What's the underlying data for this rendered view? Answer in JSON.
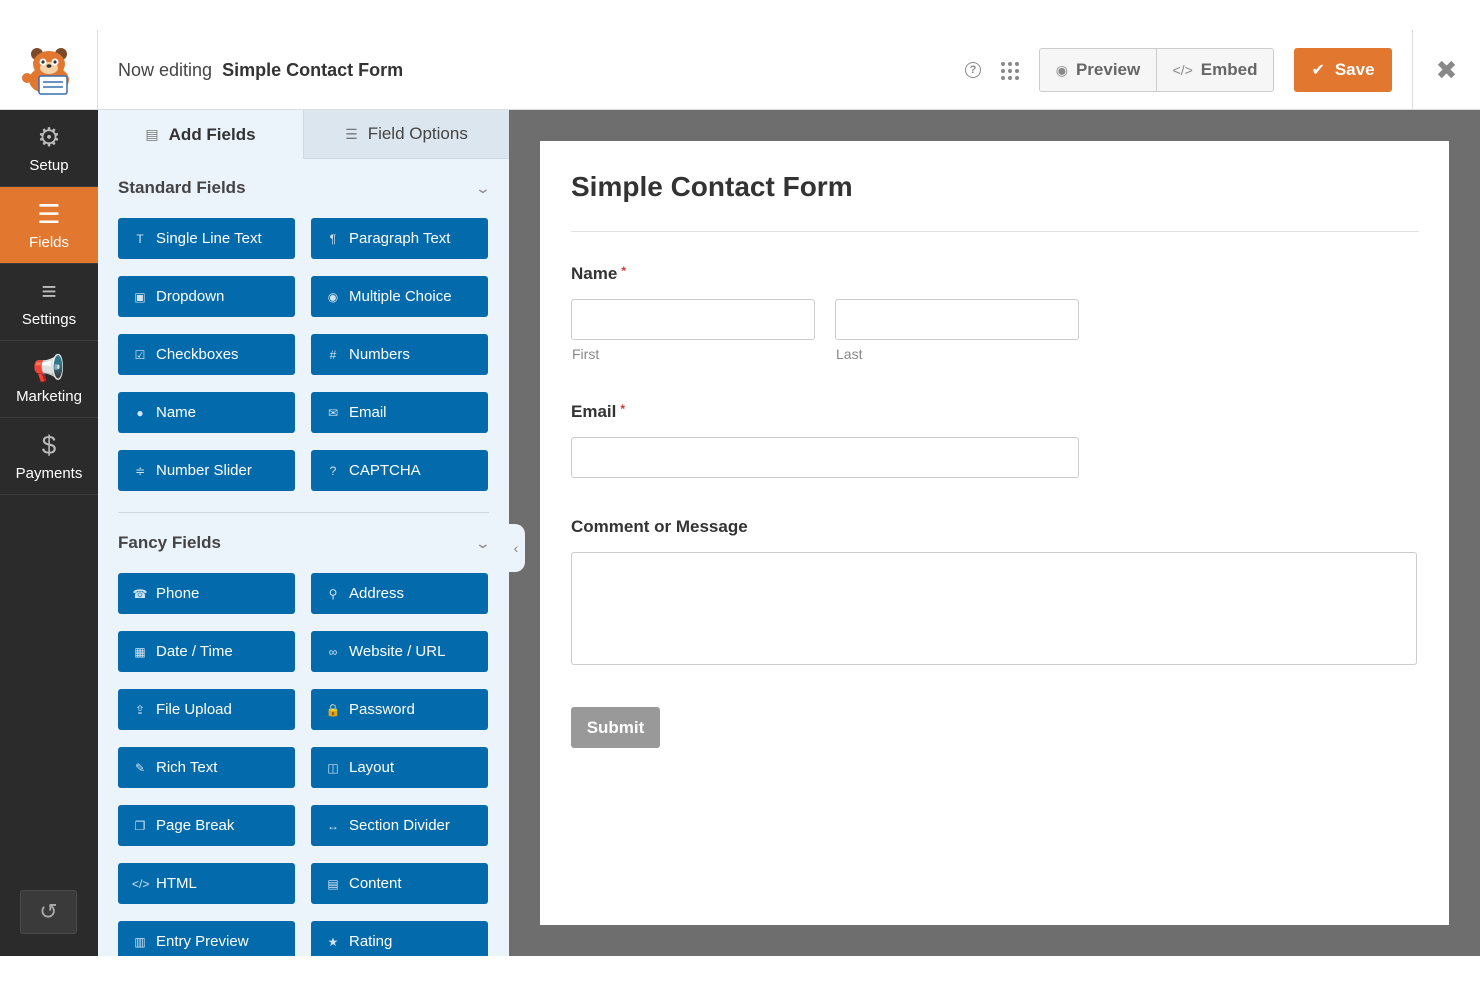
{
  "header": {
    "now_editing": "Now editing",
    "form_name": "Simple Contact Form",
    "help_glyph": "?",
    "preview_label": "Preview",
    "embed_label": "Embed",
    "save_label": "Save",
    "close_glyph": "✖",
    "accent_color": "#e27730"
  },
  "sidebar": {
    "items": [
      {
        "label": "Setup",
        "icon": "gear-icon",
        "glyph": "⚙",
        "active": false
      },
      {
        "label": "Fields",
        "icon": "list-icon",
        "glyph": "☰",
        "active": true
      },
      {
        "label": "Settings",
        "icon": "sliders-icon",
        "glyph": "≡",
        "active": false
      },
      {
        "label": "Marketing",
        "icon": "megaphone-icon",
        "glyph": "📢",
        "active": false
      },
      {
        "label": "Payments",
        "icon": "dollar-icon",
        "glyph": "$",
        "active": false
      }
    ],
    "history_glyph": "↺"
  },
  "panel": {
    "tabs": {
      "add_fields": "Add Fields",
      "field_options": "Field Options"
    },
    "standard_title": "Standard Fields",
    "fancy_title": "Fancy Fields",
    "button_color": "#036aab",
    "standard_fields": [
      {
        "label": "Single Line Text",
        "icon": "text-cursor-icon",
        "glyph": "T"
      },
      {
        "label": "Paragraph Text",
        "icon": "paragraph-icon",
        "glyph": "¶"
      },
      {
        "label": "Dropdown",
        "icon": "dropdown-icon",
        "glyph": "▣"
      },
      {
        "label": "Multiple Choice",
        "icon": "radio-icon",
        "glyph": "◉"
      },
      {
        "label": "Checkboxes",
        "icon": "checkbox-icon",
        "glyph": "☑"
      },
      {
        "label": "Numbers",
        "icon": "hash-icon",
        "glyph": "#"
      },
      {
        "label": "Name",
        "icon": "user-icon",
        "glyph": "●"
      },
      {
        "label": "Email",
        "icon": "envelope-icon",
        "glyph": "✉"
      },
      {
        "label": "Number Slider",
        "icon": "slider-icon",
        "glyph": "≑"
      },
      {
        "label": "CAPTCHA",
        "icon": "question-circle-icon",
        "glyph": "?"
      }
    ],
    "fancy_fields": [
      {
        "label": "Phone",
        "icon": "phone-icon",
        "glyph": "☎"
      },
      {
        "label": "Address",
        "icon": "map-pin-icon",
        "glyph": "⚲"
      },
      {
        "label": "Date / Time",
        "icon": "calendar-icon",
        "glyph": "▦"
      },
      {
        "label": "Website / URL",
        "icon": "link-icon",
        "glyph": "∞"
      },
      {
        "label": "File Upload",
        "icon": "upload-icon",
        "glyph": "⇪"
      },
      {
        "label": "Password",
        "icon": "lock-icon",
        "glyph": "🔒"
      },
      {
        "label": "Rich Text",
        "icon": "edit-icon",
        "glyph": "✎"
      },
      {
        "label": "Layout",
        "icon": "columns-icon",
        "glyph": "◫"
      },
      {
        "label": "Page Break",
        "icon": "copy-icon",
        "glyph": "❐"
      },
      {
        "label": "Section Divider",
        "icon": "arrows-h-icon",
        "glyph": "↔"
      },
      {
        "label": "HTML",
        "icon": "code-icon",
        "glyph": "</>"
      },
      {
        "label": "Content",
        "icon": "image-file-icon",
        "glyph": "▤"
      },
      {
        "label": "Entry Preview",
        "icon": "document-icon",
        "glyph": "▥"
      },
      {
        "label": "Rating",
        "icon": "star-icon",
        "glyph": "★"
      }
    ]
  },
  "form": {
    "title": "Simple Contact Form",
    "name_label": "Name",
    "required_mark": "*",
    "first_sublabel": "First",
    "last_sublabel": "Last",
    "email_label": "Email",
    "comment_label": "Comment or Message",
    "submit_label": "Submit"
  }
}
